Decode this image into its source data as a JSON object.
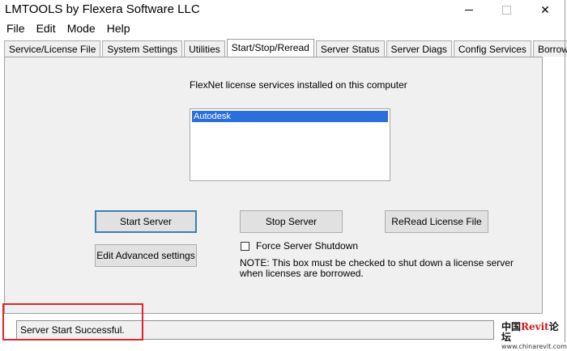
{
  "window": {
    "title": "LMTOOLS by Flexera Software LLC"
  },
  "titlebar": {
    "minimize_icon": "minimize-icon",
    "maximize_icon": "maximize-icon",
    "close_label": "✕"
  },
  "menu": {
    "items": [
      "File",
      "Edit",
      "Mode",
      "Help"
    ]
  },
  "tabs": [
    {
      "label": "Service/License File"
    },
    {
      "label": "System Settings"
    },
    {
      "label": "Utilities"
    },
    {
      "label": "Start/Stop/Reread",
      "active": true
    },
    {
      "label": "Server Status"
    },
    {
      "label": "Server Diags"
    },
    {
      "label": "Config Services"
    },
    {
      "label": "Borrowing"
    }
  ],
  "panel": {
    "services_label": "FlexNet license services installed on this computer",
    "services": [
      "Autodesk"
    ],
    "start_button": "Start Server",
    "stop_button": "Stop Server",
    "reread_button": "ReRead License File",
    "edit_button": "Edit Advanced settings",
    "force_shutdown": {
      "label": "Force Server Shutdown",
      "checked": false
    },
    "note": "NOTE:  This box must be checked to shut down a license server when licenses are borrowed."
  },
  "status": {
    "text": "Server Start Successful."
  },
  "watermark": {
    "cn1": "中国",
    "brand": "Revit",
    "cn2": "论坛",
    "url": "www.chinarevit.com"
  },
  "colors": {
    "selection": "#2a6fdc",
    "highlight": "#e0242b",
    "default_button_border": "#3c7fb1"
  }
}
